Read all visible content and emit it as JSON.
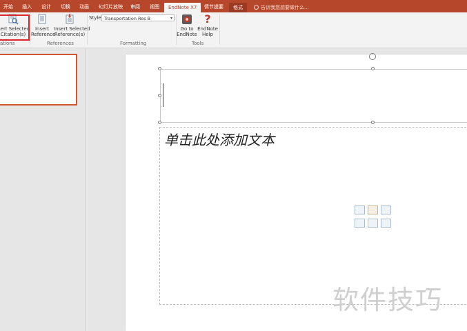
{
  "tabs": {
    "home": "开始",
    "insert": "插入",
    "design": "设计",
    "transitions": "切换",
    "animations": "动画",
    "slideshow": "幻灯片放映",
    "review": "审阅",
    "view": "视图",
    "endnote": "EndNote X7",
    "storyboard": "情节提要",
    "format": "格式",
    "tell_me": "告诉我您想要做什么..."
  },
  "ribbon": {
    "insert_selected_citation": "Insert Selected Citation(s)",
    "insert_selected_citation_line1": "sert Selected",
    "insert_selected_citation_line2": "Citation(s)",
    "group_citations": "ations",
    "insert_reference_line1": "Insert",
    "insert_reference_line2": "Reference",
    "insert_selected_reference_line1": "Insert Selected",
    "insert_selected_reference_line2": "Reference(s)",
    "group_references": "References",
    "style_label": "Style:",
    "style_value": "Transportation Res B",
    "group_formatting": "Formatting",
    "go_to_endnote_line1": "Go to",
    "go_to_endnote_line2": "EndNote",
    "endnote_help_line1": "EndNote",
    "endnote_help_line2": "Help",
    "group_tools": "Tools"
  },
  "slide": {
    "body_placeholder": "单击此处添加文本"
  },
  "watermark": "软件技巧",
  "colors": {
    "accent": "#b7472a",
    "highlight": "#d9262a",
    "thumb_border": "#d35230"
  }
}
